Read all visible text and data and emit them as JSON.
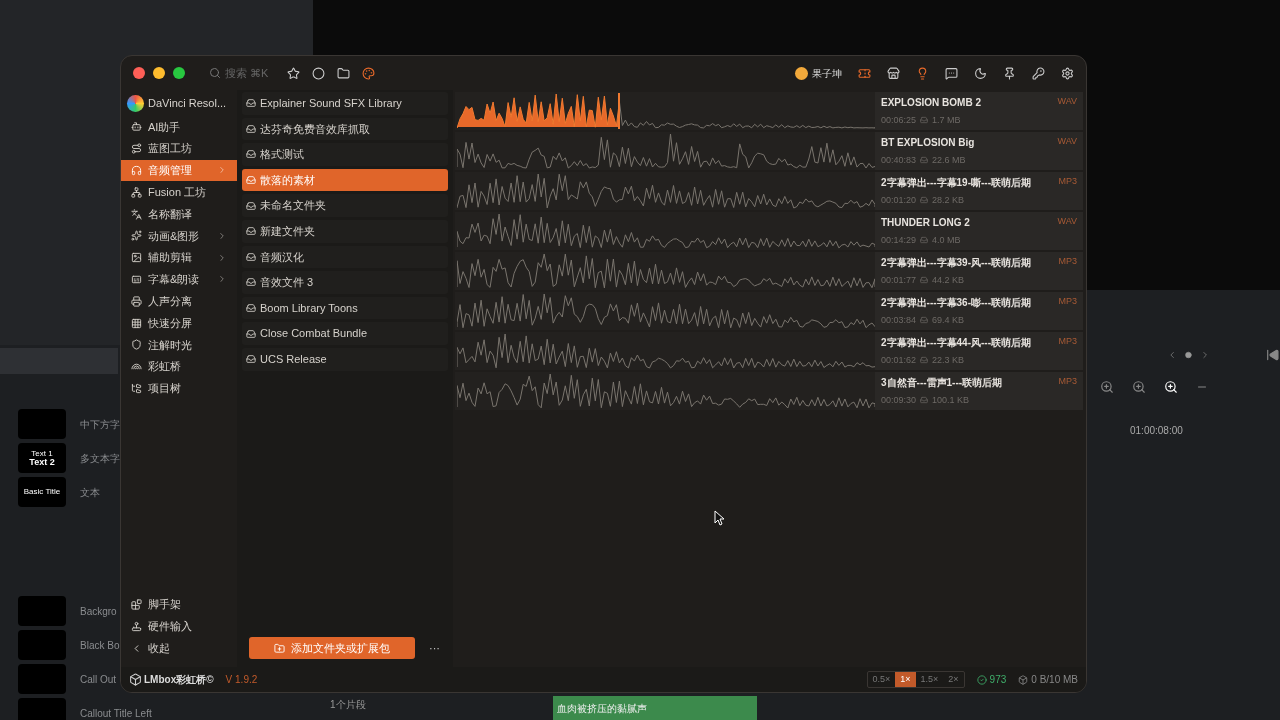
{
  "background_app": {
    "thumbnail_rows": [
      {
        "thumb_lines": [],
        "label": "中下方字"
      },
      {
        "thumb_lines": [
          "Text 1",
          "Text 2"
        ],
        "label": "多文本字"
      },
      {
        "thumb_lines": [
          "Basic Title"
        ],
        "label": "文本"
      }
    ],
    "lower_rows": [
      {
        "label": "Backgro"
      },
      {
        "label": "Black Bo"
      },
      {
        "label": "Call Out"
      },
      {
        "label": "Callout Title Left"
      }
    ],
    "timecode": "01:00:08:00",
    "track_info": "1个片段",
    "clip_label": "血肉被挤压的黏腻声"
  },
  "window": {
    "search": {
      "placeholder": "搜索 ⌘K"
    },
    "user": {
      "name": "果子坤"
    },
    "app_item": {
      "label": "DaVinci Resol..."
    },
    "sidebar": [
      {
        "label": "AI助手",
        "selected": false,
        "has_submenu": false
      },
      {
        "label": "蓝图工坊",
        "selected": false,
        "has_submenu": false
      },
      {
        "label": "音频管理",
        "selected": true,
        "has_submenu": true
      },
      {
        "label": "Fusion 工坊",
        "selected": false,
        "has_submenu": false
      },
      {
        "label": "名称翻译",
        "selected": false,
        "has_submenu": false
      },
      {
        "label": "动画&图形",
        "selected": false,
        "has_submenu": true
      },
      {
        "label": "辅助剪辑",
        "selected": false,
        "has_submenu": true
      },
      {
        "label": "字幕&朗读",
        "selected": false,
        "has_submenu": true
      },
      {
        "label": "人声分离",
        "selected": false,
        "has_submenu": false
      },
      {
        "label": "快速分屏",
        "selected": false,
        "has_submenu": false
      },
      {
        "label": "注解时光",
        "selected": false,
        "has_submenu": false
      },
      {
        "label": "彩虹桥",
        "selected": false,
        "has_submenu": false
      },
      {
        "label": "项目树",
        "selected": false,
        "has_submenu": false
      }
    ],
    "sidebar_bottom": [
      "脚手架",
      "硬件输入",
      "收起"
    ],
    "folders": [
      {
        "label": "Explainer Sound SFX Library",
        "selected": false
      },
      {
        "label": "达芬奇免费音效库抓取",
        "selected": false
      },
      {
        "label": "格式测试",
        "selected": false
      },
      {
        "label": "散落的素材",
        "selected": true
      },
      {
        "label": "未命名文件夹",
        "selected": false
      },
      {
        "label": "新建文件夹",
        "selected": false
      },
      {
        "label": "音频汉化",
        "selected": false
      },
      {
        "label": "音效文件 3",
        "selected": false
      },
      {
        "label": "Boom Library Toons",
        "selected": false
      },
      {
        "label": "Close Combat Bundle",
        "selected": false
      },
      {
        "label": "UCS Release",
        "selected": false
      }
    ],
    "add_button": "添加文件夹或扩展包",
    "more_button": "···",
    "sounds": [
      {
        "title": "EXPLOSION BOMB 2",
        "duration": "00:06:25",
        "size": "1.7 MB",
        "format": "WAV",
        "level": 0.39
      },
      {
        "title": "BT EXPLOSION Big",
        "duration": "00:40:83",
        "size": "22.6 MB",
        "format": "WAV"
      },
      {
        "title": "2字幕弹出---字幕19-嘶---联萌后期",
        "duration": "00:01:20",
        "size": "28.2 KB",
        "format": "MP3"
      },
      {
        "title": "THUNDER LONG 2",
        "duration": "00:14:29",
        "size": "4.0 MB",
        "format": "WAV"
      },
      {
        "title": "2字幕弹出---字幕39-风---联萌后期",
        "duration": "00:01:77",
        "size": "44.2 KB",
        "format": "MP3"
      },
      {
        "title": "2字幕弹出---字幕36-嘭---联萌后期",
        "duration": "00:03:84",
        "size": "69.4 KB",
        "format": "MP3"
      },
      {
        "title": "2字幕弹出---字幕44-风---联萌后期",
        "duration": "00:01:62",
        "size": "22.3 KB",
        "format": "MP3"
      },
      {
        "title": "3自然音---雷声1---联萌后期",
        "duration": "00:09:30",
        "size": "100.1 KB",
        "format": "MP3"
      }
    ],
    "footer": {
      "brand": "LMbox彩虹桥©",
      "version": "V 1.9.2",
      "speeds": [
        {
          "label": "0.5×",
          "selected": false
        },
        {
          "label": "1×",
          "selected": true
        },
        {
          "label": "1.5×",
          "selected": false
        },
        {
          "label": "2×",
          "selected": false
        }
      ],
      "count": "973",
      "storage": "0 B/10 MB"
    }
  }
}
